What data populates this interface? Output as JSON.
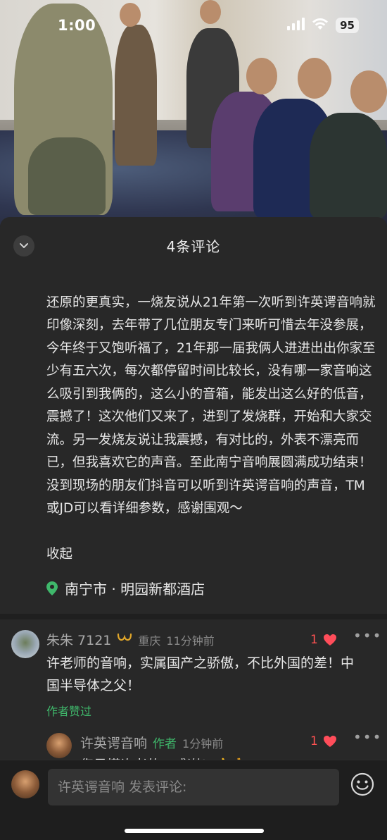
{
  "status_bar": {
    "time": "1:00",
    "battery": "95"
  },
  "sheet": {
    "title": "4条评论"
  },
  "post": {
    "text": "还原的更真实，一烧友说从21年第一次听到许英谔音响就印像深刻，去年带了几位朋友专门来听可惜去年没参展，今年终于又饱听福了，21年那一届我俩人进进出出你家至少有五六次，每次都停留时间比较长，没有哪一家音响这么吸引到我俩的，这么小的音箱，能发出这么好的低音，震撼了！这次他们又来了，进到了发烧群，开始和大家交流。另一发烧友说让我震撼，有对比的，外表不漂亮而已，但我喜欢它的声音。至此南宁音响展圆满成功结束！没到现场的朋友们抖音可以听到许英谔音响的声音，TM或JD可以看详细参数，感谢围观～",
    "collapse_label": "收起",
    "location": "南宁市 · 明园新都酒店",
    "accent_color": "#3fb86b"
  },
  "comments": [
    {
      "name": "朱朱 7121",
      "region": "重庆",
      "time": "11分钟前",
      "likes": "1",
      "text": "许老师的音响，实属国产之骄傲，不比外国的差！中国半导体之父！",
      "liked_by_author": "作者赞过"
    },
    {
      "name": "许英谔音响",
      "author_tag": "作者",
      "time": "1分钟前",
      "likes": "1",
      "text": "您是懂许老的，感谢！👍🙏"
    }
  ],
  "input": {
    "placeholder": "许英谔音响 发表评论:"
  }
}
